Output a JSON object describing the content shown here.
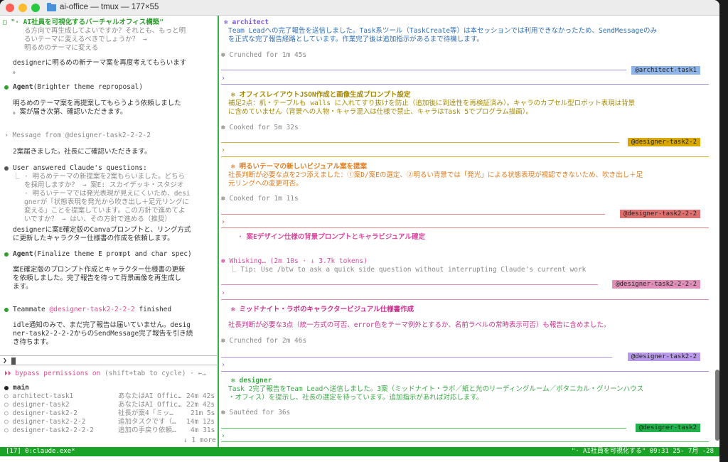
{
  "window": {
    "title": "ai-office — tmux — 177×55"
  },
  "left": {
    "task_title": "\"· AI社員を可視化するバーチャルオフィス構築\"",
    "q_lines": [
      "る方向で再生成してよいですか？それとも、もっと明",
      "るいテーマに変えるべきでしょうか？ →",
      "明るめのテーマに変える"
    ],
    "msg1_lines": [
      "designerに明るめの新テーマ案を再度考えてもらいます",
      "。"
    ],
    "agent1_label": "Agent",
    "agent1_desc": "(Brighter theme reproposal)",
    "msg2_lines": [
      "明るめのテーマ案を再提案してもらうよう依頼しました",
      "。案が届き次第、確認いただきます。"
    ],
    "message_from": "Message from @designer-task2-2-2-2",
    "msg3": "2案届きました。社長にご確認いただきます。",
    "user_answered": "User answered Claude's questions:",
    "ua_lines": [
      "· 明るめテーマの新提案を2案もらいました。どちら",
      "を採用しますか？ → 案E: スカイデッキ・スタジオ",
      "· 明るいテーマでは発光表現が見えにくいため、desi",
      "gnerが「状態表現を発光から吹き出し＋足元リングに",
      "変える」ことを提案しています。この方針で進めてよ",
      "いですか？ → はい、その方針で進める（推奨）"
    ],
    "msg4_lines": [
      "designerに案E確定版のCanvaプロンプトと、リング方式",
      "に更新したキャラクター仕様書の作成を依頼します。"
    ],
    "agent2_label": "Agent",
    "agent2_desc": "(Finalize theme E prompt and char spec)",
    "msg5_lines": [
      "案E確定版のプロンプト作成とキャラクター仕様書の更新",
      "を依頼しました。完了報告を待って背景画像を再生成し",
      "ます。"
    ],
    "teammate_label": "Teammate",
    "teammate_name": "@designer-task2-2-2-2",
    "teammate_finished": "finished",
    "msg6_lines": [
      "idle通知のみで、まだ完了報告は届いていません。desig",
      "ner-task2-2-2-2からのSendMessage完了報告を引き続",
      "き待ちます。"
    ],
    "input_prompt": "❯",
    "bypass": "⏵⏵ bypass permissions on",
    "bypass_hint": "(shift+tab to cycle) · ←…",
    "main_label": "main",
    "tasks": [
      {
        "name": "architect-task1",
        "desc": "あなたはAI Offic…",
        "time": "24m 42s"
      },
      {
        "name": "designer-task2",
        "desc": "あなたはAI Offic…",
        "time": "22m 42s"
      },
      {
        "name": "designer-task2-2",
        "desc": "社長が案4「ミッ…",
        "time": "21m 5s"
      },
      {
        "name": "designer-task2-2-2",
        "desc": "追加タスクです（…",
        "time": "14m 12s"
      },
      {
        "name": "designer-task2-2-2-2",
        "desc": "追加の手戻り依頼…",
        "time": "4m 31s"
      }
    ],
    "more": "↓ 1 more"
  },
  "right": {
    "architect_title": "architect",
    "architect_lines": [
      "Team Leadへの完了報告を送信しました。Task系ツール（TaskCreate等）は本セッションでは利用できなかったため、SendMessageのみ",
      "を正式な完了報告経路としています。作業完了後は追加指示があるまで待機します。"
    ],
    "crunched": "Crunched for 1m 45s",
    "tag1": "@architect-task1",
    "office_title": "オフィスレイアウトJSON作成と画像生成プロンプト設定",
    "office_lines": [
      "補足2点：机・テーブルも walls に入れてすり抜けを防止（追加後に到達性を再検証済み）。キャラのカプセル型ロボット表現は背景",
      "に含めていません（背景への人物・キャラ混入は仕様で禁止、キャラはTask 5でプログラム描画）。"
    ],
    "cooked": "Cooked for 5m 32s",
    "tag2": "@designer-task2-2",
    "bright_title": "明るいテーマの新しいビジュアル案を提案",
    "bright_lines": [
      "社長判断が必要な点を2つ添えました：①案D/案Eの選定、②明るい背景では「発光」による状態表現が視認できないため、吹き出し＋足",
      "元リングへの変更可否。"
    ],
    "cooked2": "Cooked for 1m 11s",
    "tag3": "@designer-task2-2-2",
    "caseE_title": "案Eデザイン仕様の背景プロンプトとキャラビジュアル確定",
    "whisking": "Whisking… (2m 10s · ↓ 3.7k tokens)",
    "tip": "Tip: Use /btw to ask a quick side question without interrupting Claude's current work",
    "tag4": "@designer-task2-2-2-2",
    "midnight_title": "ミッドナイト・ラボのキャラクタービジュアル仕様書作成",
    "midnight_line": "社長判断が必要な3点（統一方式の可否、error色をテーマ例外とするか、名前ラベルの常時表示可否）も報告に含めました。",
    "crunched2": "Crunched for 2m 46s",
    "tag5": "@designer-task2-2",
    "designer_title": "designer",
    "designer_lines": [
      "Task 2完了報告をTeam Leadへ送信しました。3案（ミッドナイト・ラボ／紙と光のリーディングルーム／ボタニカル・グリーンハウス",
      "・オフィス）を提示し、社長の選定を待っています。追加指示があれば対応します。"
    ],
    "sauteed": "Sautéed for 36s",
    "tag6": "@designer-task2",
    "word_walls": "walls"
  },
  "status": {
    "left": "[17] 0:claude.exe*",
    "right": "\"· AI社員を可視化する\" 09:31 25- 7月 -28"
  },
  "colors": {
    "architect": "#7a5ad0",
    "designer22": "#c9a400",
    "designer222": "#e06b6b",
    "designer2222": "#d9508f",
    "designer22b": "#b58de0",
    "designer2": "#1fae4a",
    "tmux_green": "#1aa326"
  }
}
